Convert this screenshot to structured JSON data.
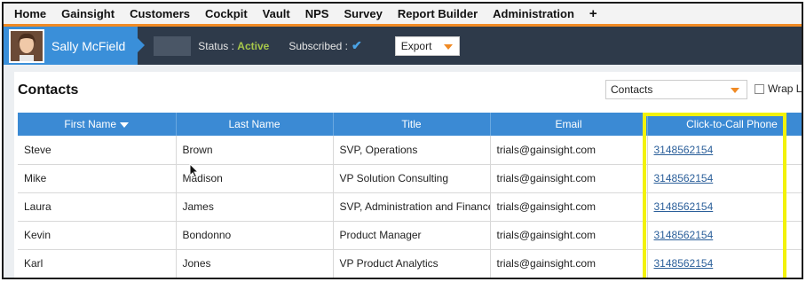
{
  "nav": {
    "items": [
      "Home",
      "Gainsight",
      "Customers",
      "Cockpit",
      "Vault",
      "NPS",
      "Survey",
      "Report Builder",
      "Administration"
    ],
    "plus_label": "+"
  },
  "customer": {
    "name": "Sally McField",
    "status_label": "Status : ",
    "status_value": "Active",
    "subscribed_label": "Subscribed : ",
    "subscribed_icon": "check-icon",
    "export_label": "Export"
  },
  "contacts": {
    "title": "Contacts",
    "selector_value": "Contacts",
    "wrap_label": "Wrap Lin",
    "columns": [
      "First Name",
      "Last Name",
      "Title",
      "Email",
      "Click-to-Call Phone"
    ],
    "rows": [
      [
        "Steve",
        "Brown",
        "SVP, Operations",
        "trials@gainsight.com",
        "3148562154"
      ],
      [
        "Mike",
        "Madison",
        "VP Solution Consulting",
        "trials@gainsight.com",
        "3148562154"
      ],
      [
        "Laura",
        "James",
        "SVP, Administration and Finance",
        "trials@gainsight.com",
        "3148562154"
      ],
      [
        "Kevin",
        "Bondonno",
        "Product Manager",
        "trials@gainsight.com",
        "3148562154"
      ],
      [
        "Karl",
        "Jones",
        "VP Product Analytics",
        "trials@gainsight.com",
        "3148562154"
      ]
    ]
  },
  "colors": {
    "accent_orange": "#f08a24",
    "header_blue": "#3b8ad4",
    "highlight_yellow": "#f2f20a",
    "active_green": "#a6c64a"
  }
}
